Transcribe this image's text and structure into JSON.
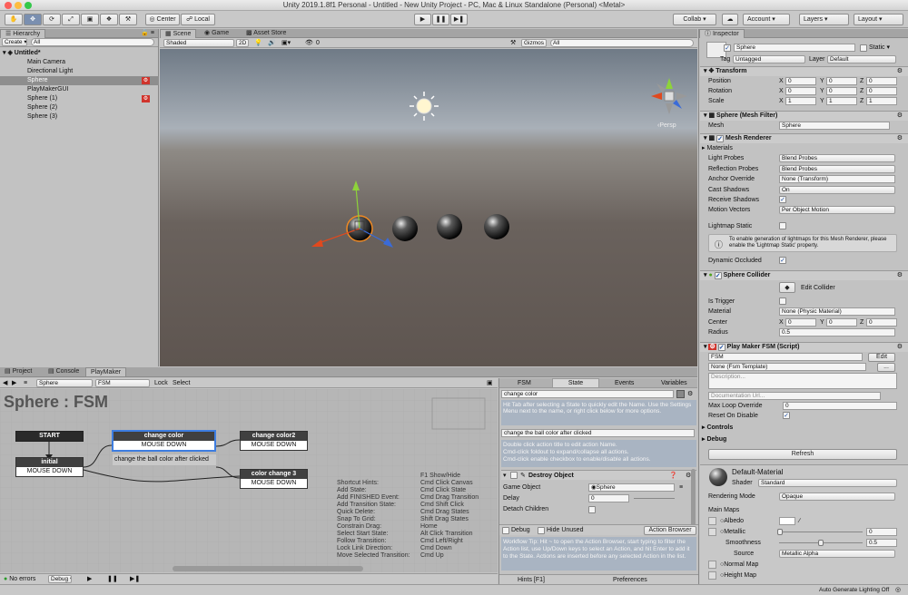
{
  "window": {
    "title": "Unity 2019.1.8f1 Personal - Untitled - New Unity Project - PC, Mac & Linux Standalone (Personal) <Metal>"
  },
  "toolbar": {
    "center": "Center",
    "local": "Local",
    "collab": "Collab ▾",
    "account": "Account",
    "layers": "Layers",
    "layout": "Layout"
  },
  "hierarchy": {
    "tab": "Hierarchy",
    "create": "Create ▾",
    "search_placeholder": "All",
    "scene": "Untitled*",
    "items": [
      "Main Camera",
      "Directional Light",
      "Sphere",
      "PlayMakerGUI",
      "Sphere (1)",
      "Sphere (2)",
      "Sphere (3)"
    ]
  },
  "scene": {
    "tabs": [
      "Scene",
      "Game",
      "Asset Store"
    ],
    "shaded": "Shaded",
    "twod": "2D",
    "gizmos": "Gizmos ▾",
    "search_placeholder": "All",
    "fx_count": "0",
    "persp": "‹Persp"
  },
  "bottom": {
    "tabs": [
      "Project",
      "Console",
      "PlayMaker"
    ],
    "object": "Sphere",
    "fsm": "FSM",
    "lock": "Lock",
    "select": "Select",
    "title": "Sphere : FSM",
    "no_errors": "No errors",
    "debug": "Debug ▾"
  },
  "fsm": {
    "start": "START",
    "initial": {
      "title": "initial",
      "event": "MOUSE DOWN"
    },
    "change_color": {
      "title": "change color",
      "event": "MOUSE DOWN"
    },
    "change_color2": {
      "title": "change color2",
      "event": "MOUSE DOWN"
    },
    "change_color3": {
      "title": "color change 3",
      "event": "MOUSE DOWN"
    },
    "comment": "change the ball color after clicked",
    "hints_header": "F1 Show/Hide",
    "hints": [
      [
        "Shortcut Hints:",
        "Cmd Click Canvas"
      ],
      [
        "Add State:",
        "Cmd Click State"
      ],
      [
        "Add FINISHED Event:",
        "Cmd Drag Transition"
      ],
      [
        "Add Transition State:",
        "Cmd Shift Click"
      ],
      [
        "Quick Delete:",
        "Cmd Drag States"
      ],
      [
        "Snap To Grid:",
        "Shift Drag States"
      ],
      [
        "Constrain Drag:",
        "Home"
      ],
      [
        "Select Start State:",
        "Alt Click Transition"
      ],
      [
        "Follow Transition:",
        "Cmd Left/Right"
      ],
      [
        "Lock Link Direction:",
        "Cmd Down"
      ],
      [
        "Move Selected Transition:",
        "Cmd Up"
      ]
    ]
  },
  "fsm_panel": {
    "tabs": [
      "FSM",
      "State",
      "Events",
      "Variables"
    ],
    "state_name": "change color",
    "name_hint": "Hit Tab after selecting a State to quickly edit the Name. Use the Settings Menu next to the name, or right click below for more options.",
    "description": "change the ball color after clicked",
    "action_hint": "Double click action title to edit action Name.\nCmd-click foldout to expand/collapse all actions.\nCmd-click enable checkbox to enable/disable all actions.",
    "action_title": "Destroy Object",
    "game_object_label": "Game Object",
    "game_object_value": "◉Sphere",
    "delay_label": "Delay",
    "delay_value": "0",
    "detach_label": "Detach Children",
    "debug": "Debug",
    "hide_unused": "Hide Unused",
    "action_browser": "Action Browser",
    "tip": "Workflow Tip: Hit ~ to open the Action Browser, start typing to filter the Action list, use Up/Down keys to select an Action, and hit Enter to add it to the State. Actions are inserted before any selected Action in the list.",
    "hints_btn": "Hints [F1]",
    "prefs_btn": "Preferences"
  },
  "inspector": {
    "tab": "Inspector",
    "name": "Sphere",
    "static": "Static ▾",
    "tag_label": "Tag",
    "tag": "Untagged",
    "layer_label": "Layer",
    "layer": "Default",
    "transform": {
      "title": "Transform",
      "rows": [
        {
          "label": "Position",
          "x": "0",
          "y": "0",
          "z": "0"
        },
        {
          "label": "Rotation",
          "x": "0",
          "y": "0",
          "z": "0"
        },
        {
          "label": "Scale",
          "x": "1",
          "y": "1",
          "z": "1"
        }
      ]
    },
    "mesh_filter": {
      "title": "Sphere (Mesh Filter)",
      "mesh_label": "Mesh",
      "mesh": "Sphere"
    },
    "mesh_renderer": {
      "title": "Mesh Renderer",
      "materials": "Materials",
      "light_probes_label": "Light Probes",
      "light_probes": "Blend Probes",
      "reflection_label": "Reflection Probes",
      "reflection": "Blend Probes",
      "anchor_label": "Anchor Override",
      "anchor": "None (Transform)",
      "cast_label": "Cast Shadows",
      "cast": "On",
      "receive_label": "Receive Shadows",
      "motion_label": "Motion Vectors",
      "motion": "Per Object Motion",
      "lightmap_label": "Lightmap Static",
      "info": "To enable generation of lightmaps for this Mesh Renderer, please enable the 'Lightmap Static' property.",
      "occluded_label": "Dynamic Occluded"
    },
    "collider": {
      "title": "Sphere Collider",
      "edit": "Edit Collider",
      "trigger_label": "Is Trigger",
      "material_label": "Material",
      "material": "None (Physic Material)",
      "center_label": "Center",
      "cx": "0",
      "cy": "0",
      "cz": "0",
      "radius_label": "Radius",
      "radius": "0.5"
    },
    "playmaker": {
      "title": "Play Maker FSM (Script)",
      "fsm": "FSM",
      "edit": "Edit",
      "template": "None (Fsm Template)",
      "desc_placeholder": "Description...",
      "doc_placeholder": "Documentation Url...",
      "loop_label": "Max Loop Override",
      "loop": "0",
      "reset_label": "Reset On Disable",
      "controls": "Controls",
      "debug": "Debug",
      "refresh": "Refresh"
    },
    "material": {
      "title": "Default-Material",
      "shader_label": "Shader",
      "shader": "Standard",
      "render_label": "Rendering Mode",
      "render": "Opaque",
      "main_maps": "Main Maps",
      "albedo": "○Albedo",
      "metallic": "○Metallic",
      "metallic_val": "0",
      "smoothness": "Smoothness",
      "smooth_val": "0.5",
      "source": "Source",
      "source_val": "Metallic Alpha",
      "normal": "○Normal Map",
      "height": "○Height Map"
    }
  },
  "status": {
    "lighting": "Auto Generate Lighting Off"
  },
  "colors": {
    "accent": "#3d7de0",
    "scene_sky": "#8b99a9",
    "scene_ground": "#6a625d"
  }
}
